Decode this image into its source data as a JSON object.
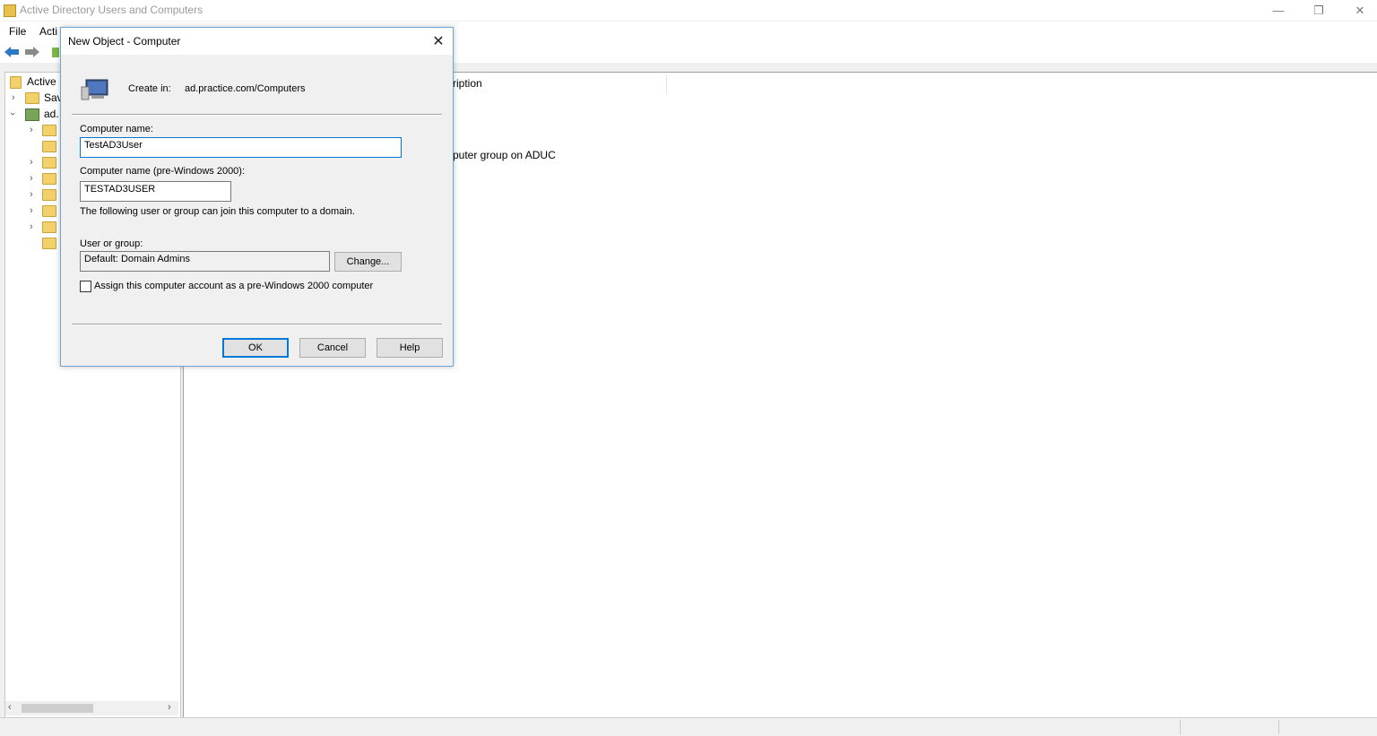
{
  "window": {
    "title": "Active Directory Users and Computers",
    "minimize_icon": "minimize-icon",
    "restore_icon": "restore-icon",
    "close_icon": "close-icon"
  },
  "menu": {
    "file": "File",
    "action": "Acti"
  },
  "toolbar": {
    "back_icon": "back-arrow-icon",
    "forward_icon": "forward-arrow-icon",
    "up_icon": "up-folder-icon"
  },
  "tree": {
    "items": [
      {
        "label": "Active"
      },
      {
        "label": "Sav"
      },
      {
        "label": "ad."
      }
    ]
  },
  "content": {
    "header_description": "ription",
    "row_description": "puter group on ADUC"
  },
  "dialog": {
    "title": "New Object - Computer",
    "create_in_label": "Create in:",
    "create_in_value": "ad.practice.com/Computers",
    "computer_name_label": "Computer name:",
    "computer_name_value": "TestAD3User",
    "pre2000_label": "Computer name (pre-Windows 2000):",
    "pre2000_value": "TESTAD3USER",
    "join_text": "The following user or group can join this computer to a domain.",
    "user_group_label": "User or group:",
    "user_group_value": "Default: Domain Admins",
    "change_button": "Change...",
    "checkbox_label": "Assign this computer account as a pre-Windows 2000 computer",
    "checkbox_checked": false,
    "ok_button": "OK",
    "cancel_button": "Cancel",
    "help_button": "Help"
  },
  "colors": {
    "accent": "#0078d7",
    "folder": "#f2d16b",
    "dialog_bg": "#f0f0f0"
  }
}
